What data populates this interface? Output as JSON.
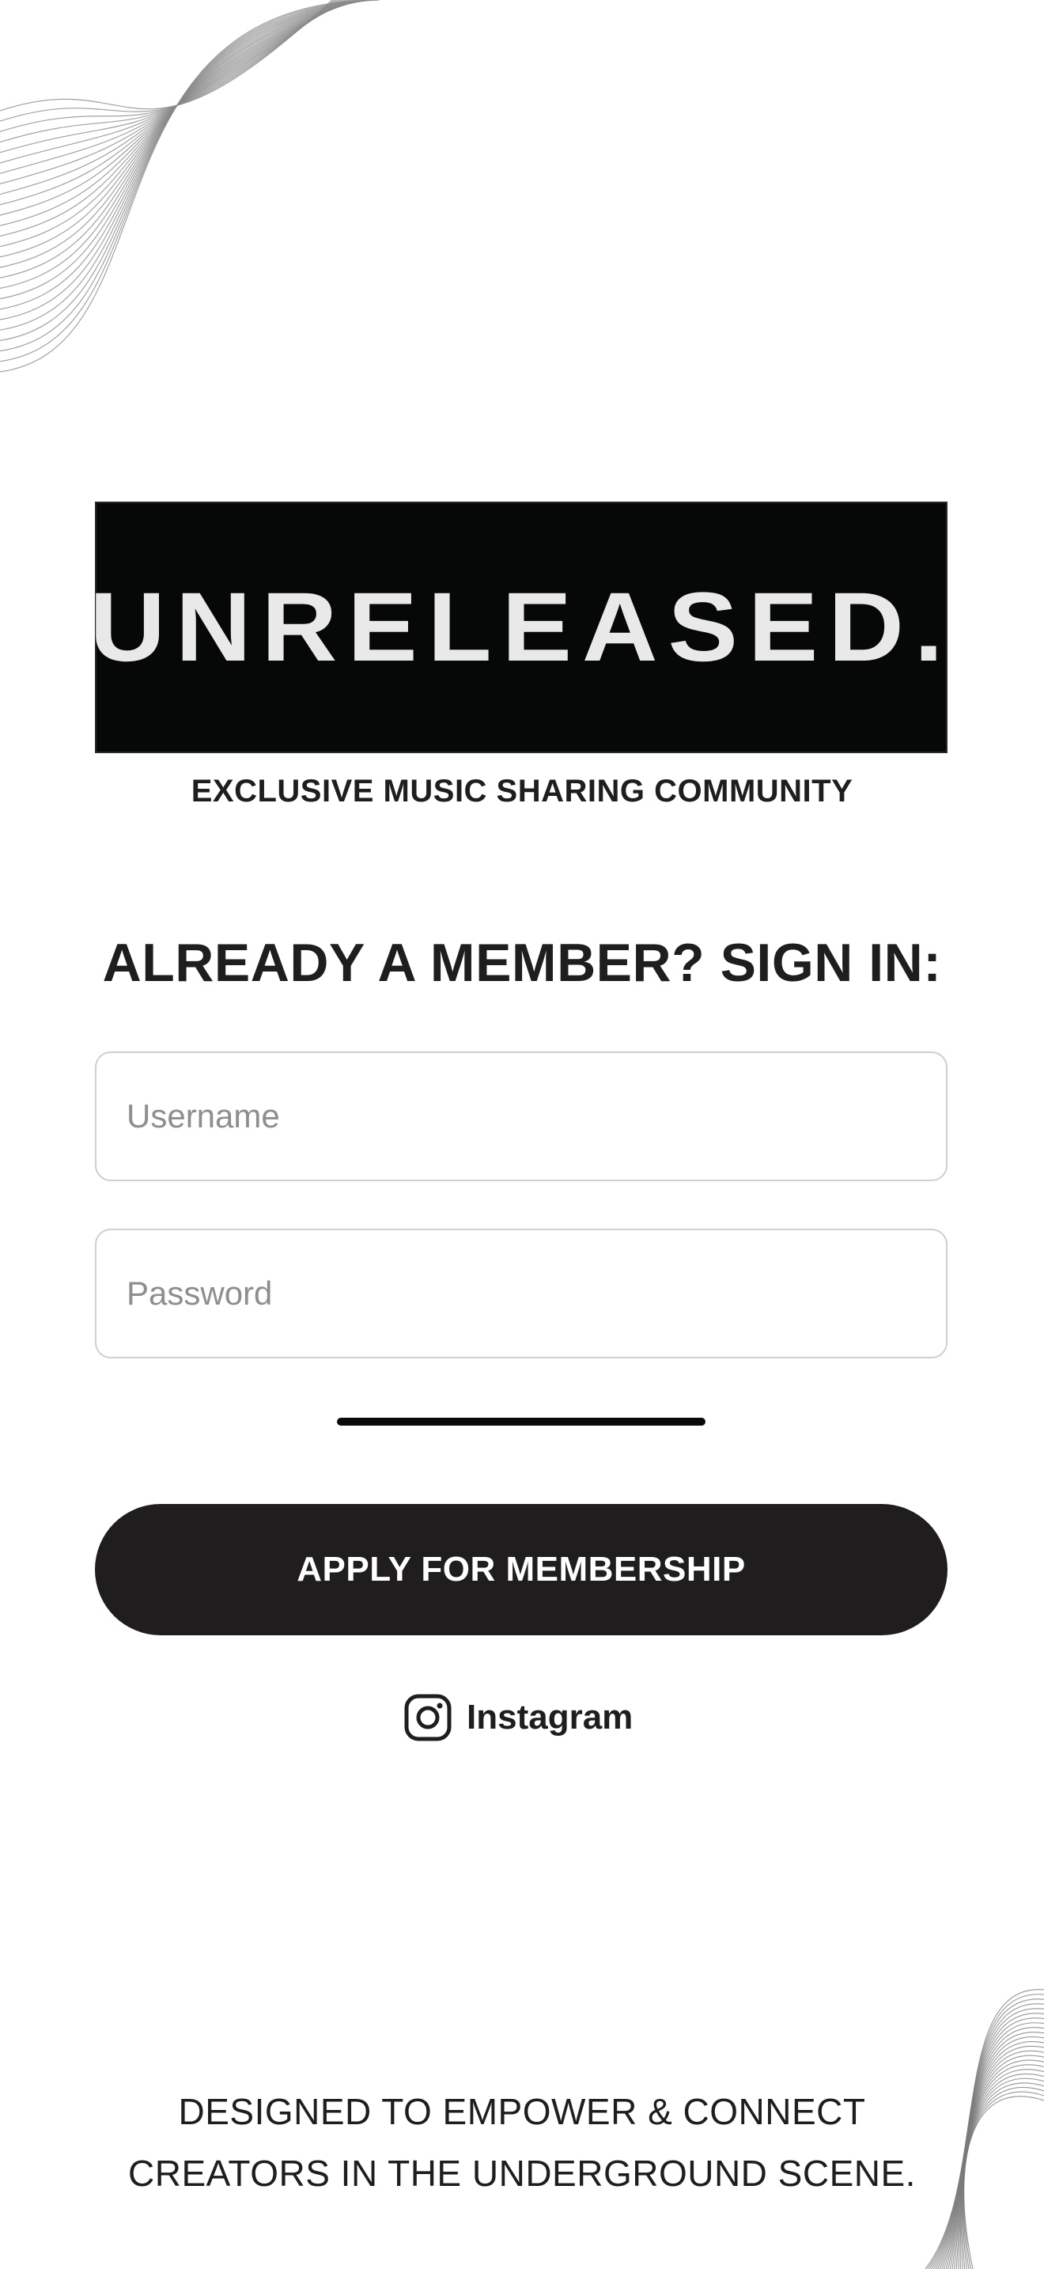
{
  "logo": {
    "text": "UNRELEASED."
  },
  "tagline": "EXCLUSIVE MUSIC SHARING COMMUNITY",
  "signin": {
    "heading": "ALREADY A MEMBER? SIGN IN:",
    "username_placeholder": "Username",
    "password_placeholder": "Password"
  },
  "apply_button_label": "APPLY FOR MEMBERSHIP",
  "instagram": {
    "label": "Instagram",
    "icon": "instagram-icon"
  },
  "footer": {
    "line1": "DESIGNED TO EMPOWER & CONNECT",
    "line2": "CREATORS IN THE UNDERGROUND SCENE."
  },
  "colors": {
    "background": "#ffffff",
    "text": "#1f1d1e",
    "logo_background": "#060707",
    "logo_text": "#e9e9e9",
    "button_background": "#1f1d1e",
    "placeholder": "#8e8e8e",
    "field_border": "#cfcfcf"
  }
}
